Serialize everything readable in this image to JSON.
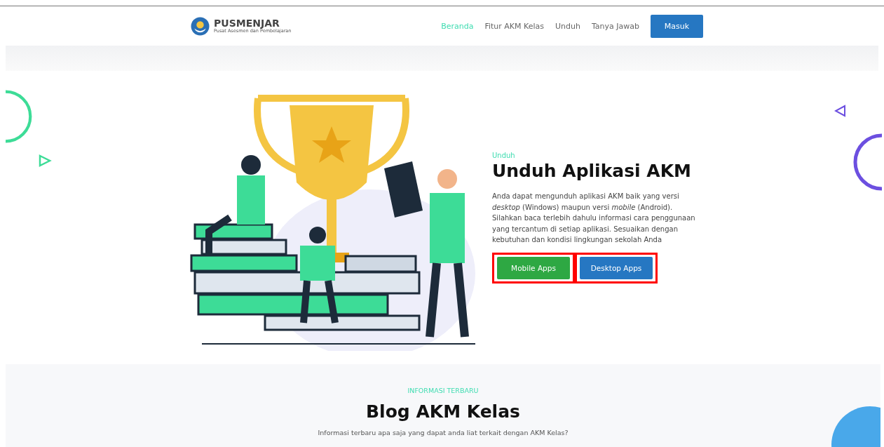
{
  "header": {
    "logo": {
      "name": "PUSMENJAR",
      "tagline": "Pusat Asesmen dan Pembelajaran"
    },
    "nav": [
      {
        "label": "Beranda",
        "selected": true
      },
      {
        "label": "Fitur AKM Kelas",
        "selected": false
      },
      {
        "label": "Unduh",
        "selected": false
      },
      {
        "label": "Tanya Jawab",
        "selected": false
      }
    ],
    "login_button": "Masuk"
  },
  "hero": {
    "eyebrow": "Unduh",
    "title": "Unduh Aplikasi AKM",
    "description": "Anda dapat mengunduh aplikasi AKM baik yang versi *desktop* (Windows) maupun versi *mobile* (Android). Silahkan baca terlebih dahulu informasi cara penggunaan yang tercantum di setiap aplikasi. Sesuaikan dengan kebutuhan dan kondisi lingkungan sekolah Anda",
    "buttons": [
      {
        "label": "Mobile Apps",
        "kind": "mobile",
        "highlighted": true
      },
      {
        "label": "Desktop Apps",
        "kind": "desktop",
        "highlighted": true
      }
    ]
  },
  "blog": {
    "eyebrow": "INFORMASI TERBARU",
    "title": "Blog AKM Kelas",
    "subtitle": "Informasi terbaru apa saja yang dapat anda liat terkait dengan AKM Kelas?"
  }
}
